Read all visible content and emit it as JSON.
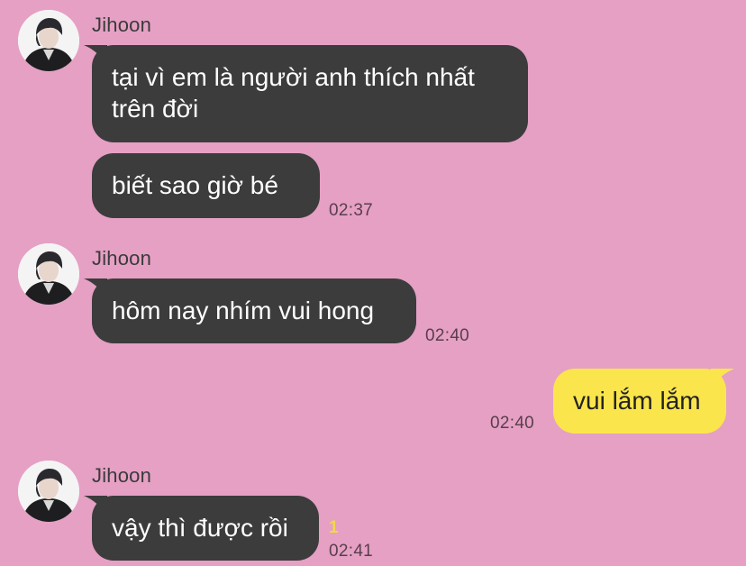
{
  "chat": {
    "groups": [
      {
        "sender": "Jihoon",
        "avatar_icon": "profile-photo",
        "messages": [
          {
            "text": "tại vì em là người anh thích nhất\ntrên đời"
          },
          {
            "text": "biết sao giờ bé",
            "time": "02:37"
          }
        ]
      },
      {
        "sender": "Jihoon",
        "avatar_icon": "profile-photo",
        "messages": [
          {
            "text": "hôm nay nhím vui hong",
            "time": "02:40"
          }
        ]
      },
      {
        "self_message": {
          "text": "vui lắm lắm",
          "time": "02:40"
        }
      },
      {
        "sender": "Jihoon",
        "avatar_icon": "profile-photo",
        "messages": [
          {
            "text": "vậy thì được rồi",
            "time": "02:41",
            "unread_count": "1"
          }
        ]
      }
    ]
  },
  "colors": {
    "background": "#e5a0c4",
    "incoming_bubble": "#3c3c3c",
    "outgoing_bubble": "#fbe54c",
    "unread_accent": "#f2d84a"
  }
}
